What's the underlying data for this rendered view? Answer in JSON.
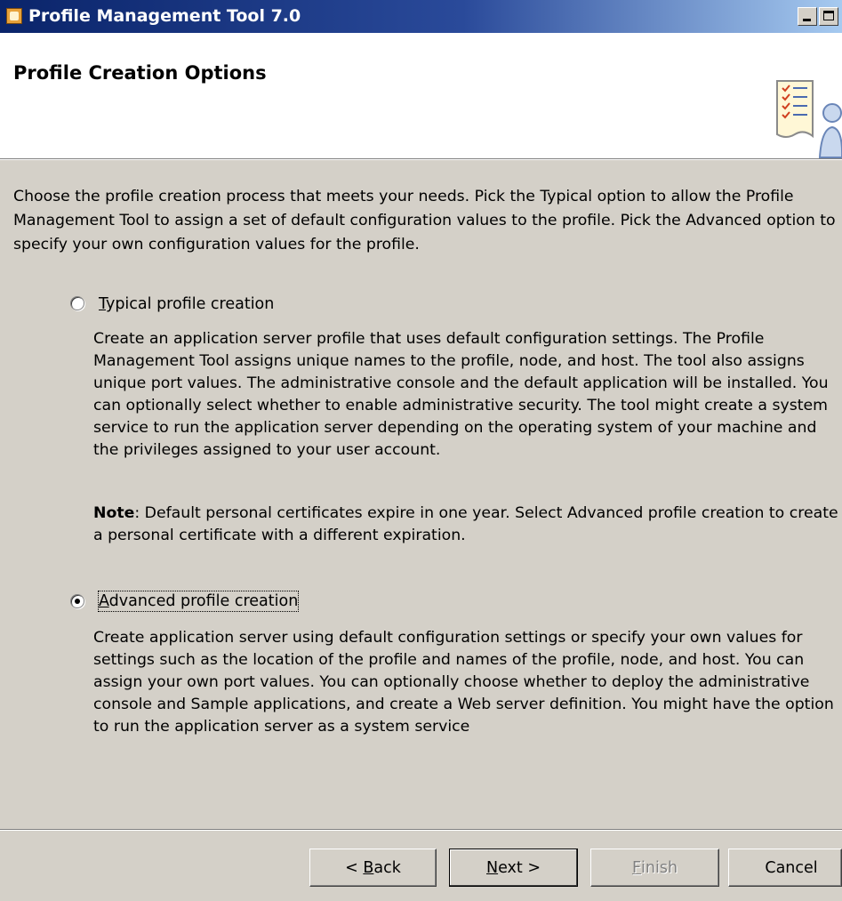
{
  "window": {
    "title": "Profile Management Tool 7.0",
    "minimize_icon": "minimize-icon",
    "maximize_icon": "maximize-icon"
  },
  "header": {
    "title": "Profile Creation Options",
    "graphic_icon": "checklist-user-icon"
  },
  "intro": {
    "text": "Choose the profile creation process that meets your needs. Pick the Typical option to allow the Profile Management Tool to assign a set of default configuration values to the profile. Pick the Advanced option to specify your own configuration values for the profile."
  },
  "options": [
    {
      "label_mnemonic": "T",
      "label_rest": "ypical profile creation",
      "selected": false,
      "description": "Create an application server profile that uses default configuration settings. The Profile Management Tool assigns unique names to the profile, node, and host. The tool also assigns unique port values. The administrative console and the default application will be installed. You can optionally select whether to enable administrative security. The tool might create a system service to run the application server depending on the operating system of your machine and the privileges assigned to your user account.",
      "note_label": "Note",
      "note_text": ": Default personal certificates expire in one year.  Select Advanced profile creation to create a personal certificate with a different expiration."
    },
    {
      "label_mnemonic": "A",
      "label_rest": "dvanced profile creation",
      "selected": true,
      "description": "Create application server using default configuration settings or specify your own values for settings such as the location of the profile and names of the profile, node, and host. You can assign your own port values. You can optionally choose whether to deploy the administrative console and Sample applications, and create a Web server definition. You might have the option to run the application server as a system service"
    }
  ],
  "buttons": {
    "back_prefix": "< ",
    "back_mnemonic": "B",
    "back_rest": "ack",
    "next_mnemonic": "N",
    "next_rest": "ext >",
    "finish_mnemonic": "F",
    "finish_rest": "inish",
    "cancel": "Cancel",
    "finish_enabled": false
  },
  "colors": {
    "title_bar_start": "#0a246a",
    "title_bar_end": "#a6caf0",
    "dialog_face": "#d4d0c8",
    "header_bg": "#ffffff",
    "disabled_text": "#808080"
  }
}
